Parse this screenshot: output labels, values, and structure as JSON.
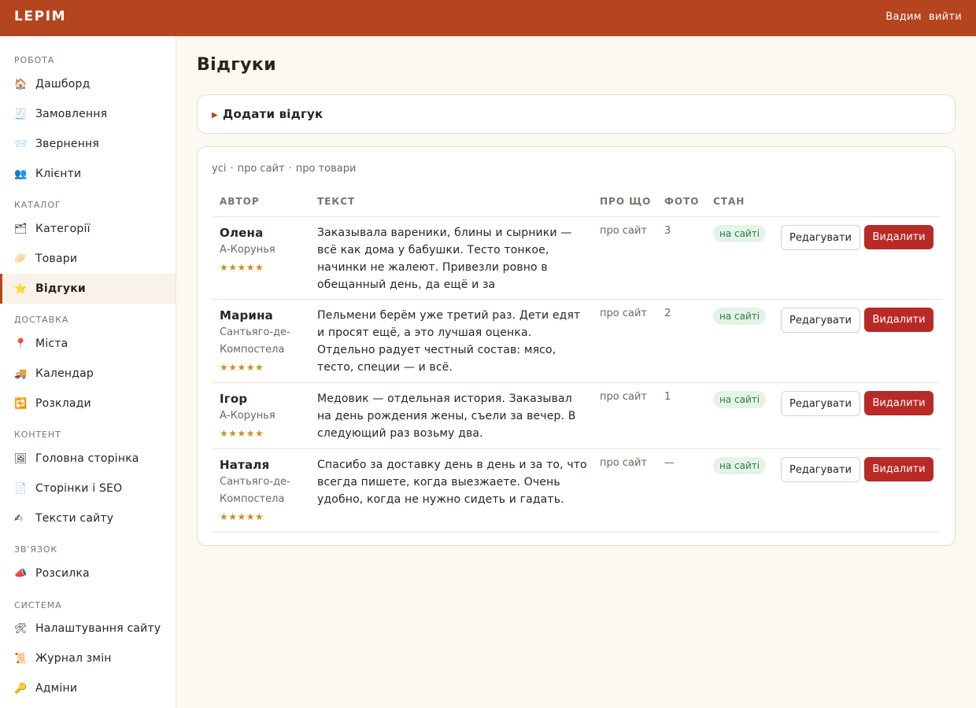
{
  "header": {
    "logo": "LEPIM",
    "user": "Вадим",
    "logout": "вийти"
  },
  "sidebar": {
    "sections": [
      {
        "title": "РОБОТА",
        "items": [
          {
            "label": "Дашборд",
            "icon": "🏠",
            "icon_name": "home-icon"
          },
          {
            "label": "Замовлення",
            "icon": "🧾",
            "icon_name": "receipt-icon"
          },
          {
            "label": "Звернення",
            "icon": "📨",
            "icon_name": "envelope-icon"
          },
          {
            "label": "Клієнти",
            "icon": "👥",
            "icon_name": "people-icon"
          }
        ]
      },
      {
        "title": "КАТАЛОГ",
        "items": [
          {
            "label": "Категорії",
            "icon": "🗂",
            "icon_name": "folders-icon"
          },
          {
            "label": "Товари",
            "icon": "🥟",
            "icon_name": "dumpling-icon"
          },
          {
            "label": "Відгуки",
            "icon": "⭐",
            "icon_name": "star-icon",
            "active": true
          }
        ]
      },
      {
        "title": "ДОСТАВКА",
        "items": [
          {
            "label": "Міста",
            "icon": "📍",
            "icon_name": "pin-icon"
          },
          {
            "label": "Календар",
            "icon": "🚚",
            "icon_name": "truck-icon"
          },
          {
            "label": "Розклади",
            "icon": "🔁",
            "icon_name": "repeat-icon"
          }
        ]
      },
      {
        "title": "КОНТЕНТ",
        "items": [
          {
            "label": "Головна сторінка",
            "icon": "🖼",
            "icon_name": "picture-icon"
          },
          {
            "label": "Сторінки і SEO",
            "icon": "📄",
            "icon_name": "page-icon"
          },
          {
            "label": "Тексти сайту",
            "icon": "✍",
            "icon_name": "writing-hand-icon"
          }
        ]
      },
      {
        "title": "ЗВ'ЯЗОК",
        "items": [
          {
            "label": "Розсилка",
            "icon": "📣",
            "icon_name": "megaphone-icon"
          }
        ]
      },
      {
        "title": "СИСТЕМА",
        "items": [
          {
            "label": "Налаштування сайту",
            "icon": "🛠",
            "icon_name": "tools-icon"
          },
          {
            "label": "Журнал змін",
            "icon": "📜",
            "icon_name": "scroll-icon"
          },
          {
            "label": "Адміни",
            "icon": "🔑",
            "icon_name": "key-icon"
          }
        ]
      }
    ]
  },
  "main": {
    "title": "Відгуки",
    "add_review": "Додати відгук",
    "filters": [
      "усі",
      "про сайт",
      "про товари"
    ],
    "filter_separator": "·",
    "columns": {
      "author": "АВТОР",
      "text": "ТЕКСТ",
      "about": "ПРО ЩО",
      "photo": "ФОТО",
      "status": "СТАН"
    },
    "edit_label": "Редагувати",
    "delete_label": "Видалити",
    "reviews": [
      {
        "name": "Олена",
        "city": "А-Корунья",
        "stars": "★★★★★",
        "rating": 5,
        "text": "Заказывала вареники, блины и сырники — всё как дома у бабушки. Тесто тонкое, начинки не жалеют. Привезли ровно в обещанный день, да ещё и за",
        "about": "про сайт",
        "photos": "3",
        "status": "на сайті"
      },
      {
        "name": "Марина",
        "city": "Сантьяго-де-Компостела",
        "stars": "★★★★★",
        "rating": 5,
        "text": "Пельмени берём уже третий раз. Дети едят и просят ещё, а это лучшая оценка. Отдельно радует честный состав: мясо, тесто, специи — и всё.",
        "about": "про сайт",
        "photos": "2",
        "status": "на сайті"
      },
      {
        "name": "Ігор",
        "city": "А-Корунья",
        "stars": "★★★★★",
        "rating": 5,
        "text": "Медовик — отдельная история. Заказывал на день рождения жены, съели за вечер. В следующий раз возьму два.",
        "about": "про сайт",
        "photos": "1",
        "status": "на сайті"
      },
      {
        "name": "Наталя",
        "city": "Сантьяго-де-Компостела",
        "stars": "★★★★★",
        "rating": 5,
        "text": "Спасибо за доставку день в день и за то, что всегда пишете, когда выезжаете. Очень удобно, когда не нужно сидеть и гадать.",
        "about": "про сайт",
        "photos": "—",
        "status": "на сайті"
      }
    ]
  }
}
